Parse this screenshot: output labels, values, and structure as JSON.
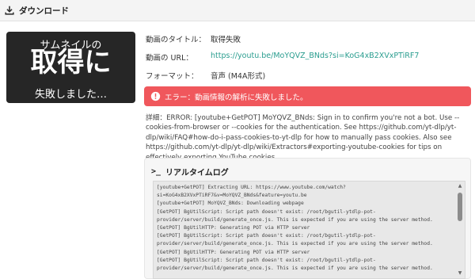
{
  "header": {
    "title": "ダウンロード"
  },
  "thumbnail": {
    "line1": "サムネイルの",
    "line2": "取得に",
    "line3": "失敗しました…"
  },
  "info": {
    "title_label": "動画のタイトル：",
    "title_value": "取得失敗",
    "url_label": "動画の URL：",
    "url_value": "https://youtu.be/MoYQVZ_BNds?si=KoG4xB2XVxPTiRF7",
    "format_label": "フォーマット：",
    "format_value": "音声 (M4A形式)"
  },
  "error": {
    "message": "エラー：動画情報の解析に失敗しました。"
  },
  "detail": {
    "text": "詳細：ERROR: [youtube+GetPOT] MoYQVZ_BNds: Sign in to confirm you're not a bot. Use --cookies-from-browser or --cookies for the authentication. See https://github.com/yt-dlp/yt-dlp/wiki/FAQ#how-do-i-pass-cookies-to-yt-dlp for how to manually pass cookies. Also see https://github.com/yt-dlp/yt-dlp/wiki/Extractors#exporting-youtube-cookies for tips on effectively exporting YouTube cookies"
  },
  "log": {
    "title": "リアルタイムログ",
    "lines": [
      "[youtube+GetPOT] Extracting URL: https://www.youtube.com/watch?",
      "si=KoG4xB2XVxPTiRF7&v=MoYQVZ_BNds&feature=youtu.be",
      "[youtube+GetPOT] MoYQVZ_BNds: Downloading webpage",
      "[GetPOT] BgUtilScript: Script path doesn't exist: /root/bgutil-ytdlp-pot-",
      "provider/server/build/generate_once.js. This is expected if you are using the server method.",
      "[GetPOT] BgUtilHTTP: Generating POT via HTTP server",
      "[GetPOT] BgUtilScript: Script path doesn't exist: /root/bgutil-ytdlp-pot-",
      "provider/server/build/generate_once.js. This is expected if you are using the server method.",
      "[GetPOT] BgUtilHTTP: Generating POT via HTTP server",
      "[GetPOT] BgUtilScript: Script path doesn't exist: /root/bgutil-ytdlp-pot-",
      "provider/server/build/generate_once.js. This is expected if you are using the server method."
    ]
  },
  "colors": {
    "accent_url": "#2a9d8f",
    "error_bg": "#f0575c",
    "thumb_bg": "#262626"
  },
  "icons": {
    "header": "download-icon",
    "error": "alert-circle-icon",
    "log": "terminal-icon"
  }
}
